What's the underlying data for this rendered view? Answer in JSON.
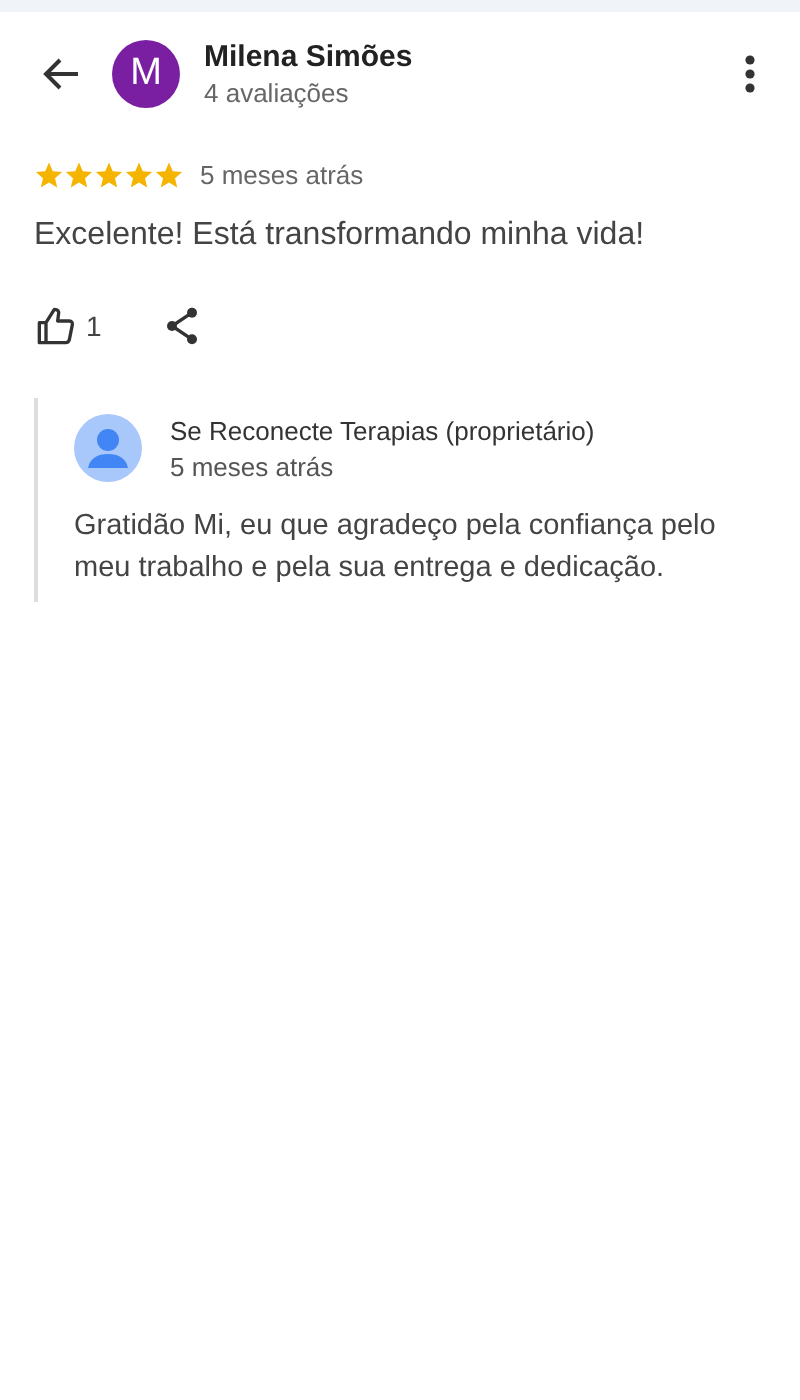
{
  "header": {
    "avatar_letter": "M",
    "name": "Milena Simões",
    "subtitle": "4 avaliações"
  },
  "review": {
    "stars": 5,
    "time": "5 meses atrás",
    "text": "Excelente! Está transformando minha vida!",
    "likes": "1"
  },
  "reply": {
    "author": "Se Reconecte Terapias (proprietário)",
    "time": "5 meses atrás",
    "text": "Gratidão Mi, eu que agradeço pela confiança pelo meu trabalho e pela sua entrega e dedicação."
  }
}
